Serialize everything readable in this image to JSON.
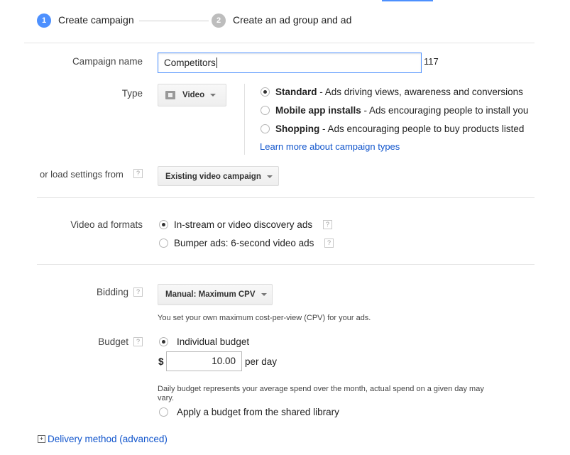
{
  "steps": [
    {
      "number": "1",
      "label": "Create campaign",
      "active": true,
      "color": "#4d90fe"
    },
    {
      "number": "2",
      "label": "Create an ad group and ad",
      "active": false,
      "color": "#bdbdbd"
    }
  ],
  "campaign_name": {
    "label": "Campaign name",
    "value": "Competitors",
    "counter": "117"
  },
  "type": {
    "label": "Type",
    "selected": "Video",
    "options": [
      {
        "title": "Standard",
        "desc": " - Ads driving views, awareness and conversions",
        "checked": true
      },
      {
        "title": "Mobile app installs",
        "desc": " - Ads encouraging people to install you",
        "checked": false
      },
      {
        "title": "Shopping",
        "desc": " - Ads encouraging people to buy products listed",
        "checked": false
      }
    ],
    "learn_more": "Learn more about campaign types"
  },
  "load_settings": {
    "label": "or load settings from",
    "help": "?",
    "dropdown": "Existing video campaign"
  },
  "video_formats": {
    "label": "Video ad formats",
    "options": [
      {
        "label": "In-stream or video discovery ads",
        "checked": true,
        "help": "?"
      },
      {
        "label": "Bumper ads: 6-second video ads",
        "checked": false,
        "help": "?"
      }
    ]
  },
  "bidding": {
    "label": "Bidding",
    "help": "?",
    "dropdown": "Manual: Maximum CPV",
    "note": "You set your own maximum cost-per-view (CPV) for your ads."
  },
  "budget": {
    "label": "Budget",
    "help": "?",
    "individual": "Individual budget",
    "currency": "$",
    "amount": "10.00",
    "per_day": "per day",
    "note": "Daily budget represents your average spend over the month, actual spend on a given day may vary.",
    "shared": "Apply a budget from the shared library"
  },
  "delivery": {
    "expand": "+",
    "label": "Delivery method (advanced)"
  },
  "colors": {
    "accent": "#4d90fe",
    "link": "#1155cc"
  }
}
